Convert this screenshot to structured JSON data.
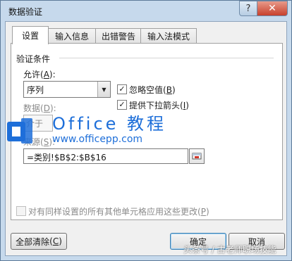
{
  "window": {
    "title": "数据验证",
    "help_glyph": "?",
    "close_glyph": "✕"
  },
  "tabs": [
    {
      "label": "设置",
      "active": true
    },
    {
      "label": "输入信息",
      "active": false
    },
    {
      "label": "出错警告",
      "active": false
    },
    {
      "label": "输入法模式",
      "active": false
    }
  ],
  "settings": {
    "group_title": "验证条件",
    "allow_label": "允许",
    "allow_key": "A",
    "allow_value": "序列",
    "ignore_blank": {
      "label": "忽略空值",
      "key": "B",
      "checked": true
    },
    "dropdown": {
      "label": "提供下拉箭头",
      "key": "I",
      "checked": true
    },
    "data_label": "数据",
    "data_key": "D",
    "data_value": "介于",
    "source_label": "来源",
    "source_key": "S",
    "source_value": "=类别!$B$2:$B$16",
    "apply_all": {
      "label": "对有同样设置的所有其他单元格应用这些更改",
      "key": "P",
      "checked": false
    }
  },
  "buttons": {
    "clear_all": "全部清除",
    "clear_all_key": "C",
    "ok": "确定",
    "cancel": "取消"
  },
  "watermark": {
    "title": "Office 教程",
    "url": "www.officepp.com",
    "bottom": "头条号 / 古老师职场技能"
  },
  "colors": {
    "accent": "#1e6fd9",
    "frame": "#c6d9ec",
    "close": "#c7402c"
  }
}
